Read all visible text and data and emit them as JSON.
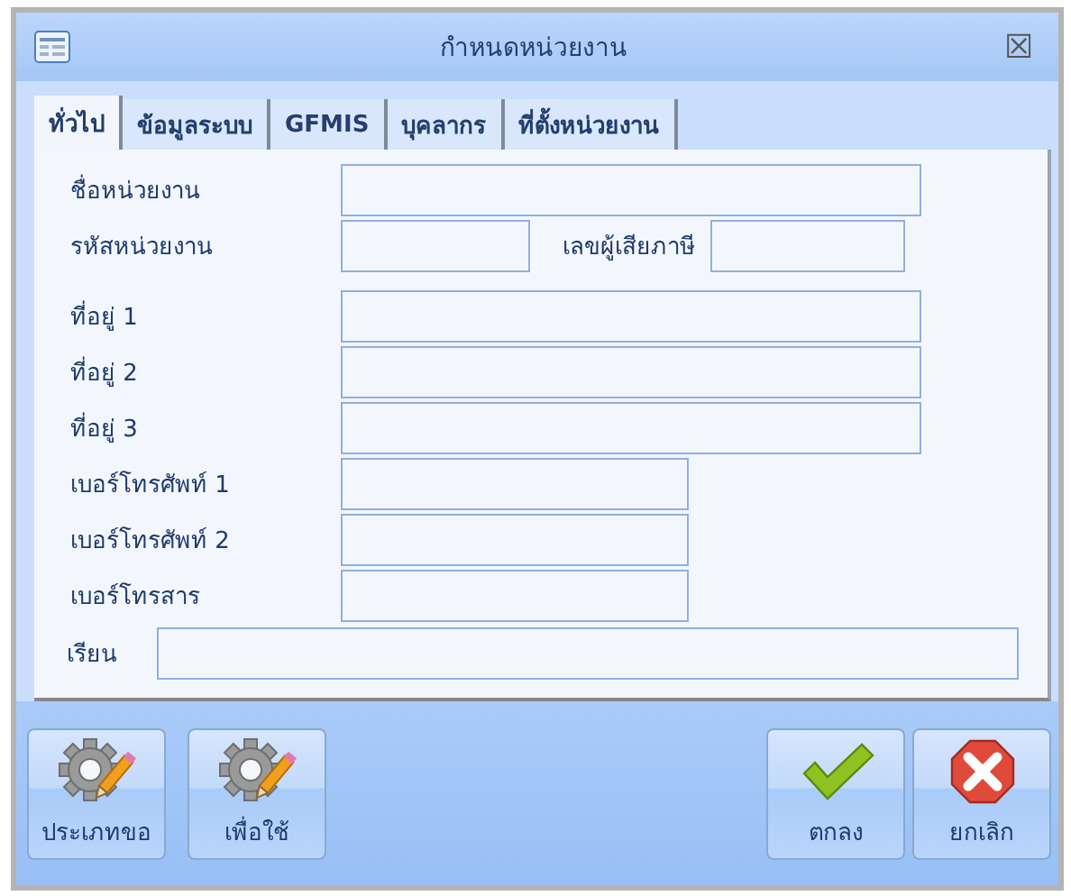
{
  "window": {
    "title": "กำหนดหน่วยงาน",
    "close": "☒"
  },
  "tabs": [
    {
      "label": "ทั่วไป",
      "selected": true
    },
    {
      "label": "ข้อมูลระบบ",
      "selected": false
    },
    {
      "label": "GFMIS",
      "selected": false
    },
    {
      "label": "บุคลากร",
      "selected": false
    },
    {
      "label": "ที่ตั้งหน่วยงาน",
      "selected": false
    }
  ],
  "field_groups": [
    [
      {
        "kind": "wide",
        "label": "ชื่อหน่วยงาน"
      },
      {
        "kind": "pair",
        "label": "รหัสหน่วยงาน",
        "label_2": "เลขผู้เสียภาษี"
      }
    ],
    [
      {
        "kind": "wide",
        "label": "ที่อยู่ 1"
      },
      {
        "kind": "wide",
        "label": "ที่อยู่ 2"
      },
      {
        "kind": "wide",
        "label": "ที่อยู่ 3"
      },
      {
        "kind": "medium",
        "label": "เบอร์โทรศัพท์ 1"
      },
      {
        "kind": "medium",
        "label": "เบอร์โทรศัพท์ 2"
      },
      {
        "kind": "medium",
        "label": "เบอร์โทรสาร"
      }
    ]
  ],
  "attention": {
    "label": "เรียน"
  },
  "left_buttons": [
    {
      "label": "ประเภทขอ",
      "kind": "settings"
    },
    {
      "label": "เพื่อใช้",
      "kind": "settings"
    }
  ],
  "right_buttons": [
    {
      "label": "ตกลง",
      "kind": "ok"
    },
    {
      "label": "ยกเลิก",
      "kind": "cancel"
    }
  ]
}
